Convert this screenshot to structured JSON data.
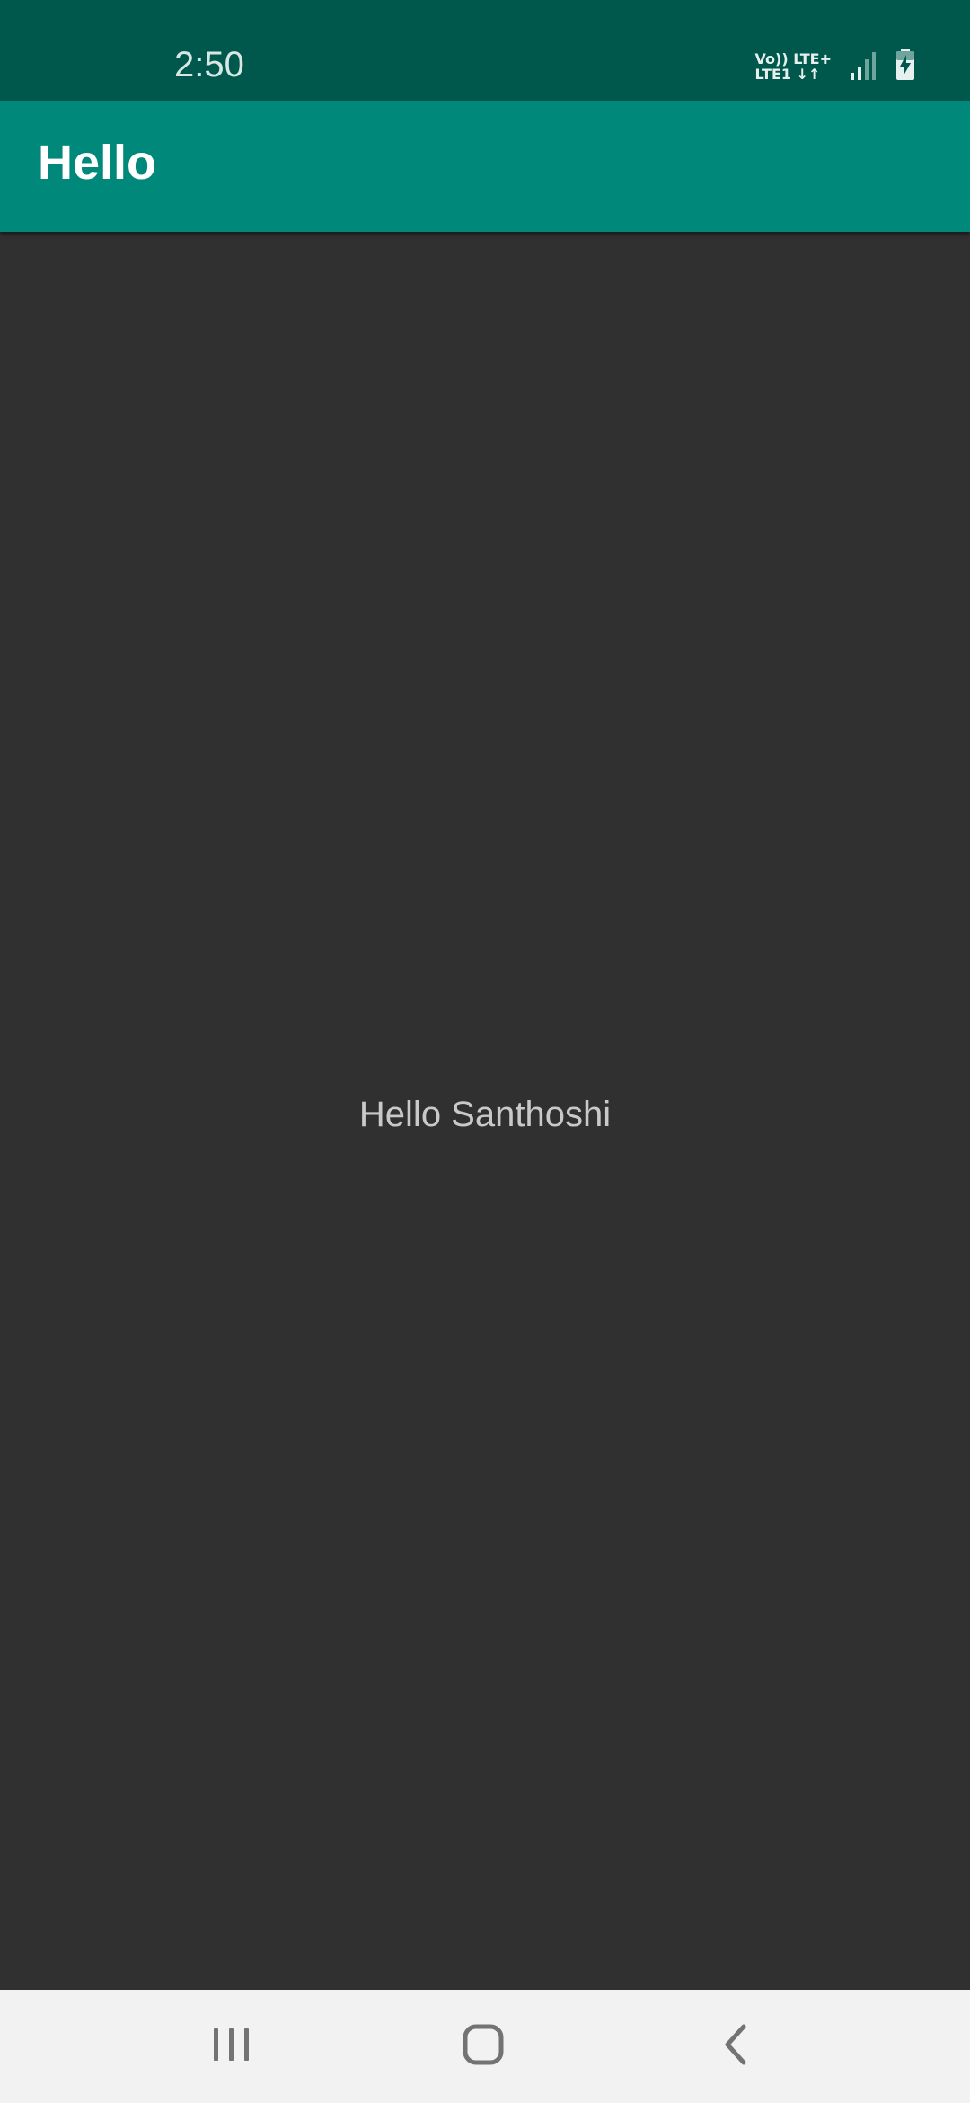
{
  "status_bar": {
    "time": "2:50",
    "volte_line1": "Vo)) LTE+",
    "volte_line2": "LTE1 ↓↑",
    "icons": [
      "volte-lte-icon",
      "signal-icon",
      "battery-charging-icon"
    ],
    "background_color": "#00574b"
  },
  "app_bar": {
    "title": "Hello",
    "background_color": "#00897b"
  },
  "main": {
    "greeting": "Hello Santhoshi",
    "background_color": "#303030"
  },
  "nav_bar": {
    "buttons": [
      "recents-icon",
      "home-icon",
      "back-icon"
    ],
    "background_color": "#f2f2f2"
  }
}
